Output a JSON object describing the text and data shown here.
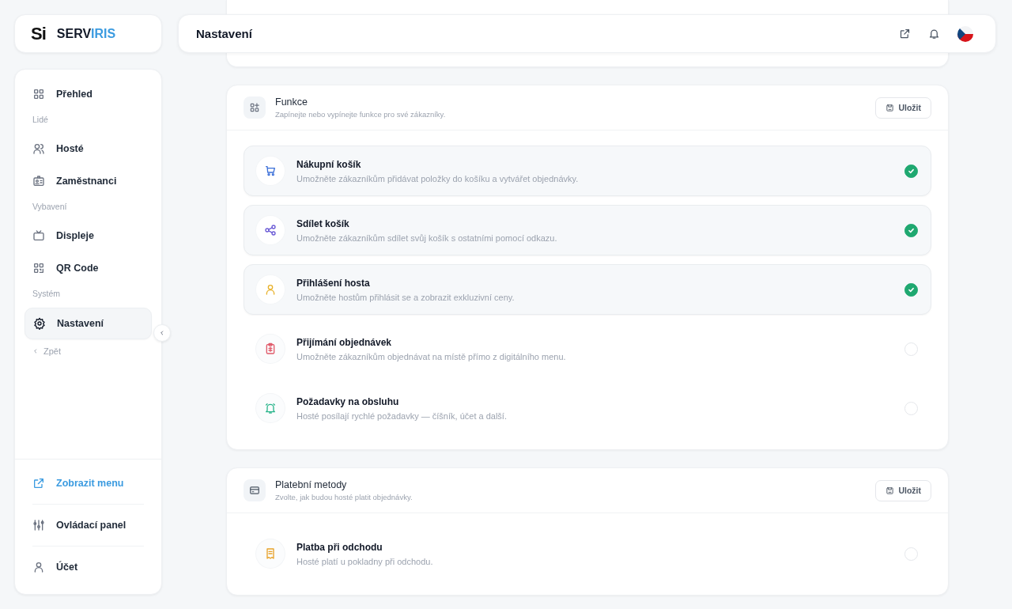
{
  "logo": {
    "mark": "Si",
    "name_dark": "SERV",
    "name_accent": "IRIS"
  },
  "header": {
    "title": "Nastavení"
  },
  "sidebar": {
    "items": [
      {
        "kind": "item",
        "label": "Přehled",
        "selected": false
      },
      {
        "kind": "heading",
        "label": "Lidé"
      },
      {
        "kind": "item",
        "label": "Hosté",
        "selected": false
      },
      {
        "kind": "item",
        "label": "Zaměstnanci",
        "selected": false
      },
      {
        "kind": "heading",
        "label": "Vybavení"
      },
      {
        "kind": "item",
        "label": "Displeje",
        "selected": false
      },
      {
        "kind": "item",
        "label": "QR Code",
        "selected": false
      },
      {
        "kind": "heading",
        "label": "Systém"
      },
      {
        "kind": "item",
        "label": "Nastavení",
        "selected": true
      },
      {
        "kind": "back",
        "label": "Zpět"
      }
    ],
    "footer": [
      {
        "kind": "link",
        "label": "Zobrazit menu"
      },
      {
        "kind": "item",
        "label": "Ovládací panel"
      },
      {
        "kind": "item",
        "label": "Účet"
      }
    ]
  },
  "features_card": {
    "title": "Funkce",
    "subtitle": "Zapínejte nebo vypínejte funkce pro své zákazníky.",
    "save": "Uložit",
    "features": [
      {
        "title": "Nákupní košík",
        "description": "Umožněte zákazníkům přidávat položky do košíku a vytvářet objednávky.",
        "checked": true
      },
      {
        "title": "Sdílet košík",
        "description": "Umožněte zákazníkům sdílet svůj košík s ostatními pomocí odkazu.",
        "checked": true
      },
      {
        "title": "Přihlášení hosta",
        "description": "Umožněte hostům přihlásit se a zobrazit exkluzivní ceny.",
        "checked": true
      },
      {
        "title": "Přijímání objednávek",
        "description": "Umožněte zákazníkům objednávat na místě přímo z digitálního menu.",
        "checked": false
      },
      {
        "title": "Požadavky na obsluhu",
        "description": "Hosté posílají rychlé požadavky — číšník, účet a další.",
        "checked": false
      }
    ]
  },
  "payment_card": {
    "title": "Platební metody",
    "subtitle": "Zvolte, jak budou hosté platit objednávky.",
    "save": "Uložit",
    "methods": [
      {
        "title": "Platba při odchodu",
        "description": "Hosté platí u pokladny při odchodu.",
        "checked": false
      }
    ]
  }
}
